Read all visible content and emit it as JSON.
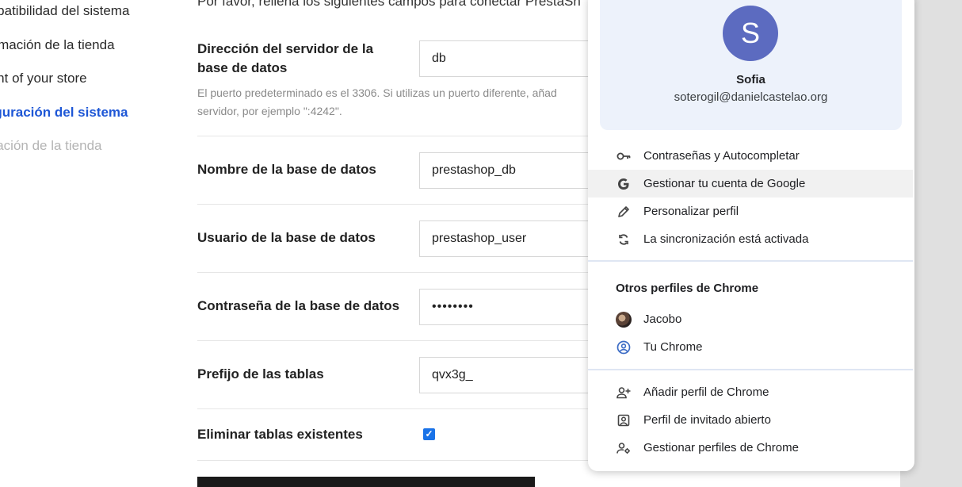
{
  "sidebar": {
    "steps": [
      {
        "label": "mpatibilidad del sistema",
        "state": "done"
      },
      {
        "label": "ormación de la tienda",
        "state": "done"
      },
      {
        "label": "tent of your store",
        "state": "done"
      },
      {
        "label": "figuración del sistema",
        "state": "active"
      },
      {
        "label": "alación de la tienda",
        "state": "disabled"
      }
    ]
  },
  "form": {
    "intro": "Por favor, rellena los siguientes campos para conectar PrestaSh",
    "db_server": {
      "label": "Dirección del servidor de la base de datos",
      "value": "db"
    },
    "db_help": "El puerto predeterminado es el 3306. Si utilizas un puerto diferente, añad servidor, por ejemplo \":4242\".",
    "db_name": {
      "label": "Nombre de la base de datos",
      "value": "prestashop_db"
    },
    "db_user": {
      "label": "Usuario de la base de datos",
      "value": "prestashop_user"
    },
    "db_password": {
      "label": "Contraseña de la base de datos",
      "value": "••••••••"
    },
    "table_prefix": {
      "label": "Prefijo de las tablas",
      "value": "qvx3g_"
    },
    "drop_tables": {
      "label": "Eliminar tablas existentes",
      "checked": true
    }
  },
  "profile": {
    "initial": "S",
    "name": "Sofia",
    "email": "soterogil@danielcastelao.org",
    "avatar_color": "#5c6bc0"
  },
  "menu": {
    "items": [
      {
        "label": "Contraseñas y Autocompletar",
        "icon": "key-icon"
      },
      {
        "label": "Gestionar tu cuenta de Google",
        "icon": "google-g-icon"
      },
      {
        "label": "Personalizar perfil",
        "icon": "pencil-icon"
      },
      {
        "label": "La sincronización está activada",
        "icon": "sync-icon"
      }
    ],
    "other_profiles_title": "Otros perfiles de Chrome",
    "other_profiles": [
      {
        "label": "Jacobo",
        "icon": "profile-photo-icon"
      },
      {
        "label": "Tu Chrome",
        "icon": "account-circle-icon"
      }
    ],
    "actions": [
      {
        "label": "Añadir perfil de Chrome",
        "icon": "add-person-icon"
      },
      {
        "label": "Perfil de invitado abierto",
        "icon": "guest-profile-icon"
      },
      {
        "label": "Gestionar perfiles de Chrome",
        "icon": "manage-profiles-icon"
      }
    ]
  }
}
